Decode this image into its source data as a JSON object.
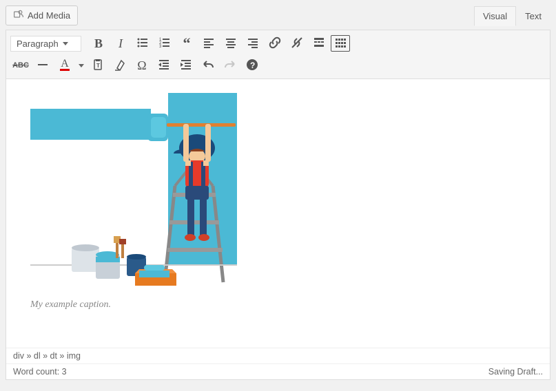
{
  "top": {
    "add_media": "Add Media"
  },
  "tabs": {
    "visual": "Visual",
    "text": "Text"
  },
  "toolbar": {
    "format": "Paragraph"
  },
  "content": {
    "caption": "My example caption."
  },
  "status": {
    "path": "div » dl » dt » img",
    "word_count_label": "Word count:",
    "word_count_value": "3",
    "save_status": "Saving Draft..."
  }
}
